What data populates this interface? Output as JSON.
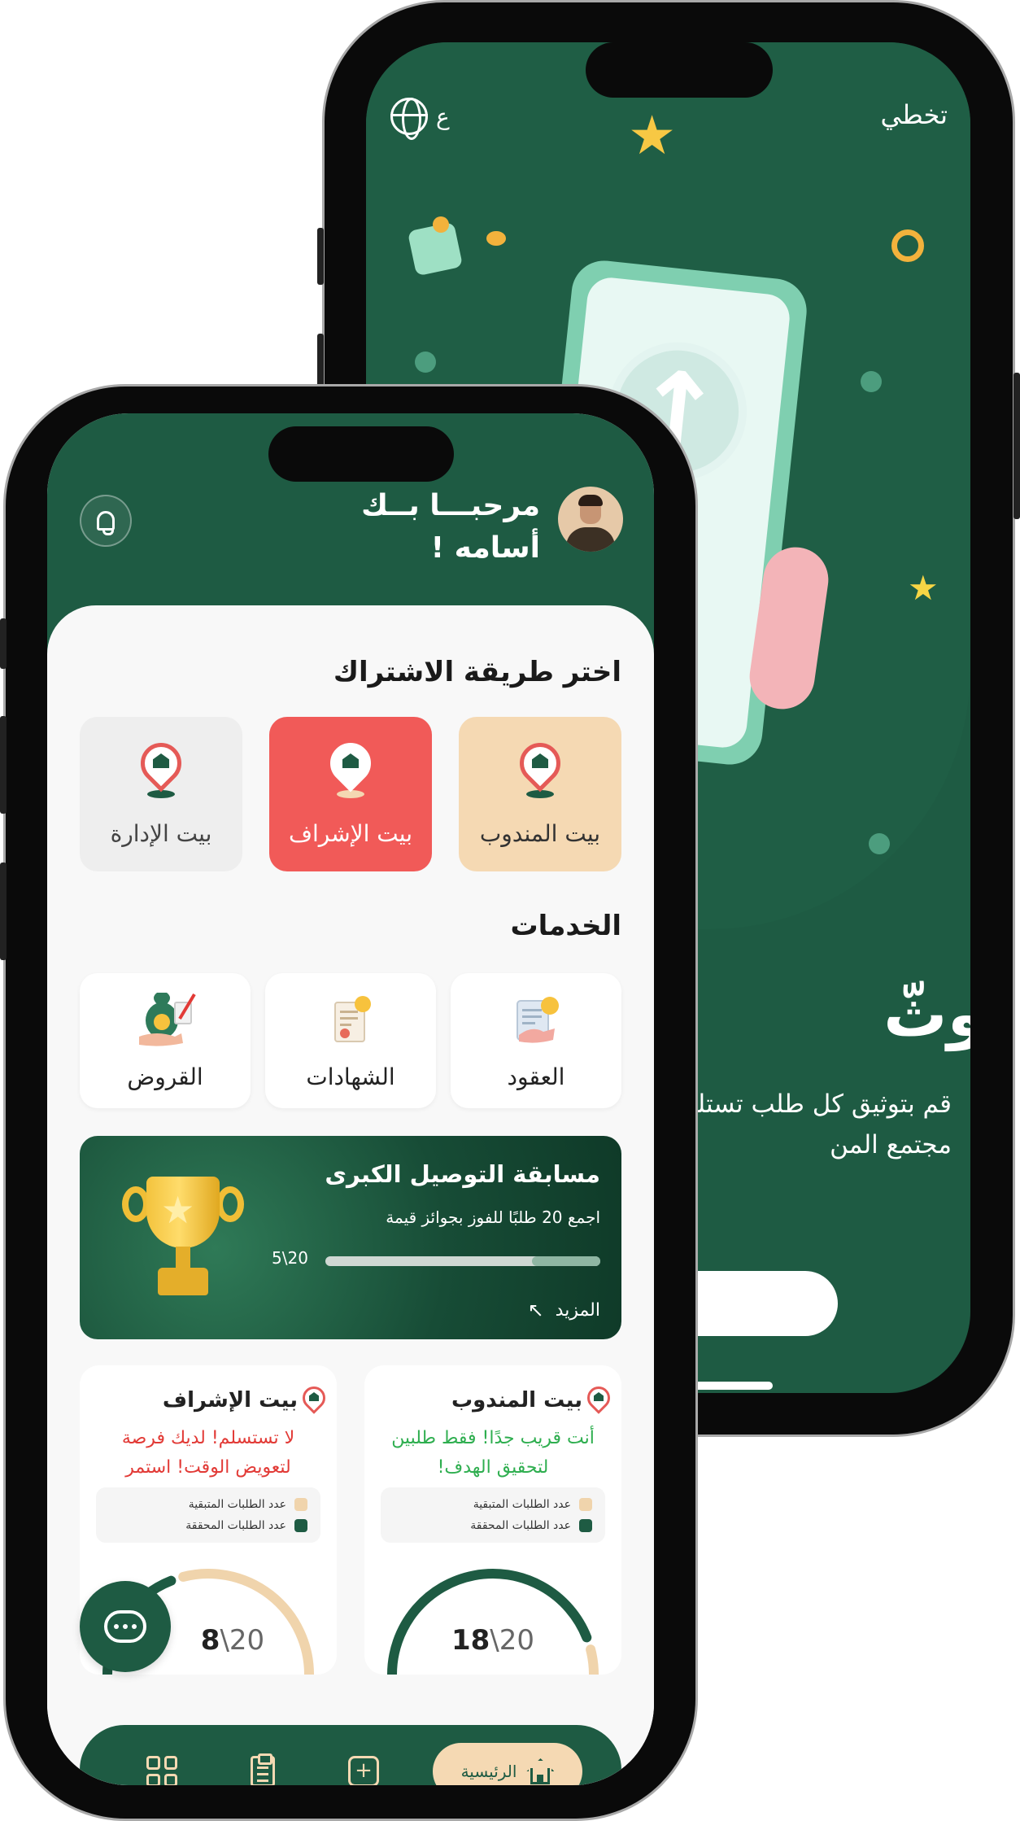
{
  "colors": {
    "brand_green": "#1e5b43",
    "tile_peach": "#f5d9b3",
    "tile_red": "#f15a58",
    "tile_gray": "#eeeeee",
    "success_green": "#2eae4f",
    "alert_red": "#e23a36",
    "gauge_track": "#f0d4ac"
  },
  "onboarding": {
    "skip_label": "تخطي",
    "language_label": "ع",
    "language_icon": "globe-icon",
    "title": "وثّ",
    "description_line1": "قم بتوثيق كل طلب تستلم",
    "description_line2": "مجتمع المن"
  },
  "header": {
    "greeting_line1": "مرحبـــا بــك",
    "greeting_line2": "أسامه !",
    "notification_icon": "bell-icon",
    "avatar_icon": "user-avatar"
  },
  "subscription": {
    "title": "اختر طريقة الاشتراك",
    "options": [
      {
        "label": "بيت المندوب",
        "selected": false,
        "color": "#f5d9b3",
        "text_color": "#333333"
      },
      {
        "label": "بيت الإشراف",
        "selected": true,
        "color": "#f15a58",
        "text_color": "#ffffff"
      },
      {
        "label": "بيت الإدارة",
        "selected": false,
        "color": "#eeeeee",
        "text_color": "#444444"
      }
    ]
  },
  "services": {
    "title": "الخدمات",
    "items": [
      {
        "label": "العقود",
        "icon": "contract-handshake-icon"
      },
      {
        "label": "الشهادات",
        "icon": "certificate-icon"
      },
      {
        "label": "القروض",
        "icon": "money-bag-icon"
      }
    ]
  },
  "promo": {
    "title": "مسابقة التوصيل الكبرى",
    "subtitle": "اجمع 20 طلبًا للفوز بجوائز قيمة",
    "progress_label": "5\\20",
    "progress_value": 5,
    "progress_total": 20,
    "more_label": "المزيد",
    "more_icon": "arrow-up-left-icon",
    "trophy_icon": "trophy-icon"
  },
  "stats": [
    {
      "title": "بيت المندوب",
      "message_line1": "أنت قريب جدًا! فقط طلبين",
      "message_line2": "لتحقيق الهدف!",
      "message_color": "#2eae4f",
      "legend_remaining": "عدد الطلبات المتبقية",
      "legend_achieved": "عدد الطلبات المحققة",
      "achieved": 18,
      "total": 20,
      "value_bold": "18",
      "value_rest": "\\20"
    },
    {
      "title": "بيت الإشراف",
      "message_line1": "لا تستسلم! لديك فرصة",
      "message_line2": "لتعويض الوقت! استمر",
      "message_color": "#e23a36",
      "legend_remaining": "عدد الطلبات المتبقية",
      "legend_achieved": "عدد الطلبات المحققة",
      "achieved": 8,
      "total": 20,
      "value_bold": "8",
      "value_rest": "\\20"
    }
  ],
  "chat": {
    "icon": "chat-bubble-icon"
  },
  "bottom_nav": {
    "home_label": "الرئيسية",
    "items": [
      "home-icon",
      "add-icon",
      "clipboard-icon",
      "grid-icon"
    ]
  }
}
